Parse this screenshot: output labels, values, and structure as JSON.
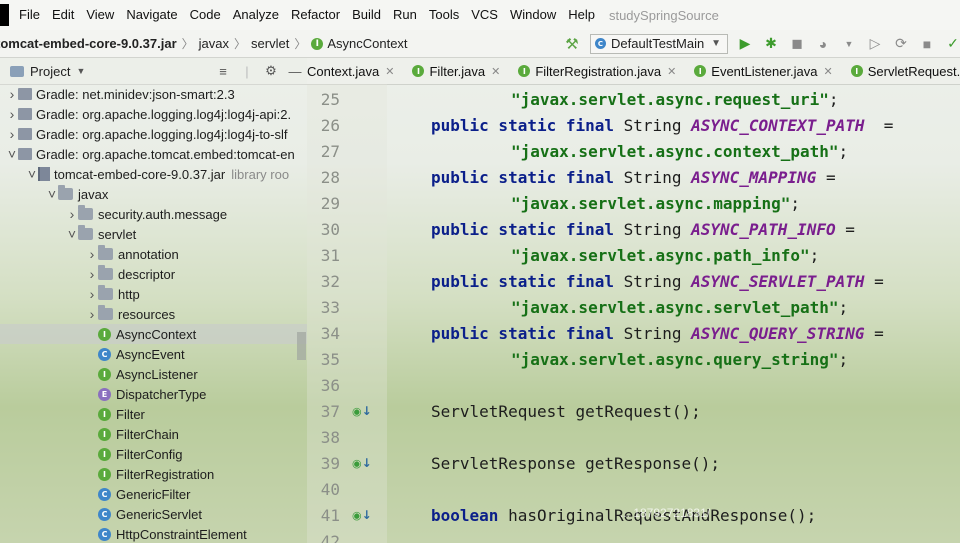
{
  "menubar": {
    "items": [
      "File",
      "Edit",
      "View",
      "Navigate",
      "Code",
      "Analyze",
      "Refactor",
      "Build",
      "Run",
      "Tools",
      "VCS",
      "Window",
      "Help"
    ],
    "project_title": "studySpringSource"
  },
  "navbar": {
    "crumbs": [
      "tomcat-embed-core-9.0.37.jar",
      "javax",
      "servlet"
    ],
    "current": "AsyncContext",
    "run_config": "DefaultTestMain"
  },
  "project_panel": {
    "title": "Project",
    "tree": [
      {
        "label": "Gradle: net.minidev:json-smart:2.3",
        "kind": "lib",
        "depth": 0,
        "arrow": "right"
      },
      {
        "label": "Gradle: org.apache.logging.log4j:log4j-api:2.",
        "kind": "lib",
        "depth": 0,
        "arrow": "right"
      },
      {
        "label": "Gradle: org.apache.logging.log4j:log4j-to-slf",
        "kind": "lib",
        "depth": 0,
        "arrow": "right"
      },
      {
        "label": "Gradle: org.apache.tomcat.embed:tomcat-en",
        "kind": "lib",
        "depth": 0,
        "arrow": "down"
      },
      {
        "label": "tomcat-embed-core-9.0.37.jar",
        "kind": "jar",
        "depth": 1,
        "arrow": "down",
        "note": "library roo"
      },
      {
        "label": "javax",
        "kind": "pkg",
        "depth": 2,
        "arrow": "down"
      },
      {
        "label": "security.auth.message",
        "kind": "pkg",
        "depth": 3,
        "arrow": "right"
      },
      {
        "label": "servlet",
        "kind": "pkg",
        "depth": 3,
        "arrow": "down"
      },
      {
        "label": "annotation",
        "kind": "pkg",
        "depth": 4,
        "arrow": "right"
      },
      {
        "label": "descriptor",
        "kind": "pkg",
        "depth": 4,
        "arrow": "right"
      },
      {
        "label": "http",
        "kind": "pkg",
        "depth": 4,
        "arrow": "right"
      },
      {
        "label": "resources",
        "kind": "pkg",
        "depth": 4,
        "arrow": "right"
      },
      {
        "label": "AsyncContext",
        "kind": "I",
        "depth": 4,
        "selected": true
      },
      {
        "label": "AsyncEvent",
        "kind": "C",
        "depth": 4
      },
      {
        "label": "AsyncListener",
        "kind": "I",
        "depth": 4
      },
      {
        "label": "DispatcherType",
        "kind": "E",
        "depth": 4
      },
      {
        "label": "Filter",
        "kind": "I",
        "depth": 4
      },
      {
        "label": "FilterChain",
        "kind": "I",
        "depth": 4
      },
      {
        "label": "FilterConfig",
        "kind": "I",
        "depth": 4
      },
      {
        "label": "FilterRegistration",
        "kind": "I",
        "depth": 4
      },
      {
        "label": "GenericFilter",
        "kind": "C",
        "depth": 4
      },
      {
        "label": "GenericServlet",
        "kind": "C",
        "depth": 4
      },
      {
        "label": "HttpConstraintElement",
        "kind": "C",
        "depth": 4
      }
    ]
  },
  "tabs": [
    {
      "label": "Context.java",
      "kind": "I"
    },
    {
      "label": "Filter.java",
      "kind": "I"
    },
    {
      "label": "FilterRegistration.java",
      "kind": "I"
    },
    {
      "label": "EventListener.java",
      "kind": "I"
    },
    {
      "label": "ServletRequest.java",
      "kind": "I"
    }
  ],
  "code": [
    {
      "n": "25",
      "parts": [
        [
          "str",
          "\"javax.servlet.async.request_uri\""
        ],
        [
          "txt",
          ";"
        ]
      ],
      "indent": 8
    },
    {
      "n": "26",
      "parts": [
        [
          "kw",
          "public static final "
        ],
        [
          "txt",
          "String "
        ],
        [
          "const",
          "ASYNC_CONTEXT_PATH"
        ],
        [
          "txt",
          "  ="
        ]
      ],
      "indent": 4
    },
    {
      "n": "27",
      "parts": [
        [
          "str",
          "\"javax.servlet.async.context_path\""
        ],
        [
          "txt",
          ";"
        ]
      ],
      "indent": 8
    },
    {
      "n": "28",
      "parts": [
        [
          "kw",
          "public static final "
        ],
        [
          "txt",
          "String "
        ],
        [
          "const",
          "ASYNC_MAPPING"
        ],
        [
          "txt",
          " ="
        ]
      ],
      "indent": 4
    },
    {
      "n": "29",
      "parts": [
        [
          "str",
          "\"javax.servlet.async.mapping\""
        ],
        [
          "txt",
          ";"
        ]
      ],
      "indent": 8
    },
    {
      "n": "30",
      "parts": [
        [
          "kw",
          "public static final "
        ],
        [
          "txt",
          "String "
        ],
        [
          "const",
          "ASYNC_PATH_INFO"
        ],
        [
          "txt",
          " ="
        ]
      ],
      "indent": 4
    },
    {
      "n": "31",
      "parts": [
        [
          "str",
          "\"javax.servlet.async.path_info\""
        ],
        [
          "txt",
          ";"
        ]
      ],
      "indent": 8
    },
    {
      "n": "32",
      "parts": [
        [
          "kw",
          "public static final "
        ],
        [
          "txt",
          "String "
        ],
        [
          "const",
          "ASYNC_SERVLET_PATH"
        ],
        [
          "txt",
          " ="
        ]
      ],
      "indent": 4
    },
    {
      "n": "33",
      "parts": [
        [
          "str",
          "\"javax.servlet.async.servlet_path\""
        ],
        [
          "txt",
          ";"
        ]
      ],
      "indent": 8
    },
    {
      "n": "34",
      "parts": [
        [
          "kw",
          "public static final "
        ],
        [
          "txt",
          "String "
        ],
        [
          "const",
          "ASYNC_QUERY_STRING"
        ],
        [
          "txt",
          " ="
        ]
      ],
      "indent": 4
    },
    {
      "n": "35",
      "parts": [
        [
          "str",
          "\"javax.servlet.async.query_string\""
        ],
        [
          "txt",
          ";"
        ]
      ],
      "indent": 8
    },
    {
      "n": "36",
      "parts": [],
      "indent": 0
    },
    {
      "n": "37",
      "parts": [
        [
          "txt",
          "ServletRequest getRequest();"
        ]
      ],
      "indent": 4,
      "gutter": true
    },
    {
      "n": "38",
      "parts": [],
      "indent": 0
    },
    {
      "n": "39",
      "parts": [
        [
          "txt",
          "ServletResponse getResponse();"
        ]
      ],
      "indent": 4,
      "gutter": true
    },
    {
      "n": "40",
      "parts": [],
      "indent": 0
    },
    {
      "n": "41",
      "parts": [
        [
          "kw",
          "boolean "
        ],
        [
          "txt",
          "hasOriginalRequestAndResponse();"
        ]
      ],
      "indent": 4,
      "gutter": true
    },
    {
      "n": "42",
      "parts": [],
      "indent": 0
    }
  ],
  "watermark": "... 18792721831/"
}
